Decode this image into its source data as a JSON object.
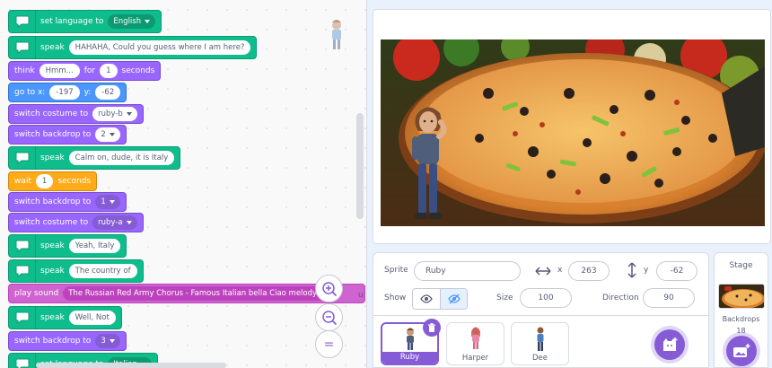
{
  "blocks": {
    "b1": {
      "label": "set language to",
      "value": "English"
    },
    "b2": {
      "label": "speak",
      "value": "HAHAHA, Could you guess where I am here?"
    },
    "b3": {
      "label": "think",
      "value": "Hmm...",
      "for": "for",
      "secs": "1",
      "seconds": "seconds"
    },
    "b4": {
      "label": "go to x:",
      "x": "-197",
      "ylabel": "y:",
      "y": "-62"
    },
    "b5": {
      "label": "switch costume to",
      "value": "ruby-b"
    },
    "b6": {
      "label": "switch backdrop to",
      "value": "2"
    },
    "b7": {
      "label": "speak",
      "value": "Calm on, dude, it is Italy"
    },
    "b8": {
      "label": "wait",
      "value": "1",
      "seconds": "seconds"
    },
    "b9": {
      "label": "switch backdrop to",
      "value": "1"
    },
    "b10": {
      "label": "switch costume to",
      "value": "ruby-a"
    },
    "b11": {
      "label": "speak",
      "value": "Yeah, Italy"
    },
    "b12": {
      "label": "speak",
      "value": "The country of"
    },
    "b13": {
      "label": "play sound",
      "value": "The Russian Red Army Chorus - Famous Italian bella Ciao melody",
      "trail": "u"
    },
    "b14": {
      "label": "speak",
      "value": "Well, Not"
    },
    "b15": {
      "label": "switch backdrop to",
      "value": "3"
    },
    "b16": {
      "label": "set language to",
      "value": "Italian"
    }
  },
  "zoom": {
    "in": "zoom-in",
    "out": "zoom-out",
    "reset": "="
  },
  "sprite_info": {
    "sprite_label": "Sprite",
    "sprite_name": "Ruby",
    "x_label": "x",
    "x": "263",
    "y_label": "y",
    "y": "-62",
    "show_label": "Show",
    "size_label": "Size",
    "size": "100",
    "direction_label": "Direction",
    "direction": "90"
  },
  "sprites": [
    {
      "name": "Ruby",
      "selected": true
    },
    {
      "name": "Harper",
      "selected": false
    },
    {
      "name": "Dee",
      "selected": false
    }
  ],
  "stage_selector": {
    "title": "Stage",
    "backdrops_label": "Backdrops",
    "backdrops_count": "18"
  },
  "colors": {
    "looks": "#9966ff",
    "motion": "#4c97ff",
    "control": "#ffab19",
    "sound": "#cf63cf",
    "extension": "#0fbd8c",
    "accent": "#855cd6"
  }
}
